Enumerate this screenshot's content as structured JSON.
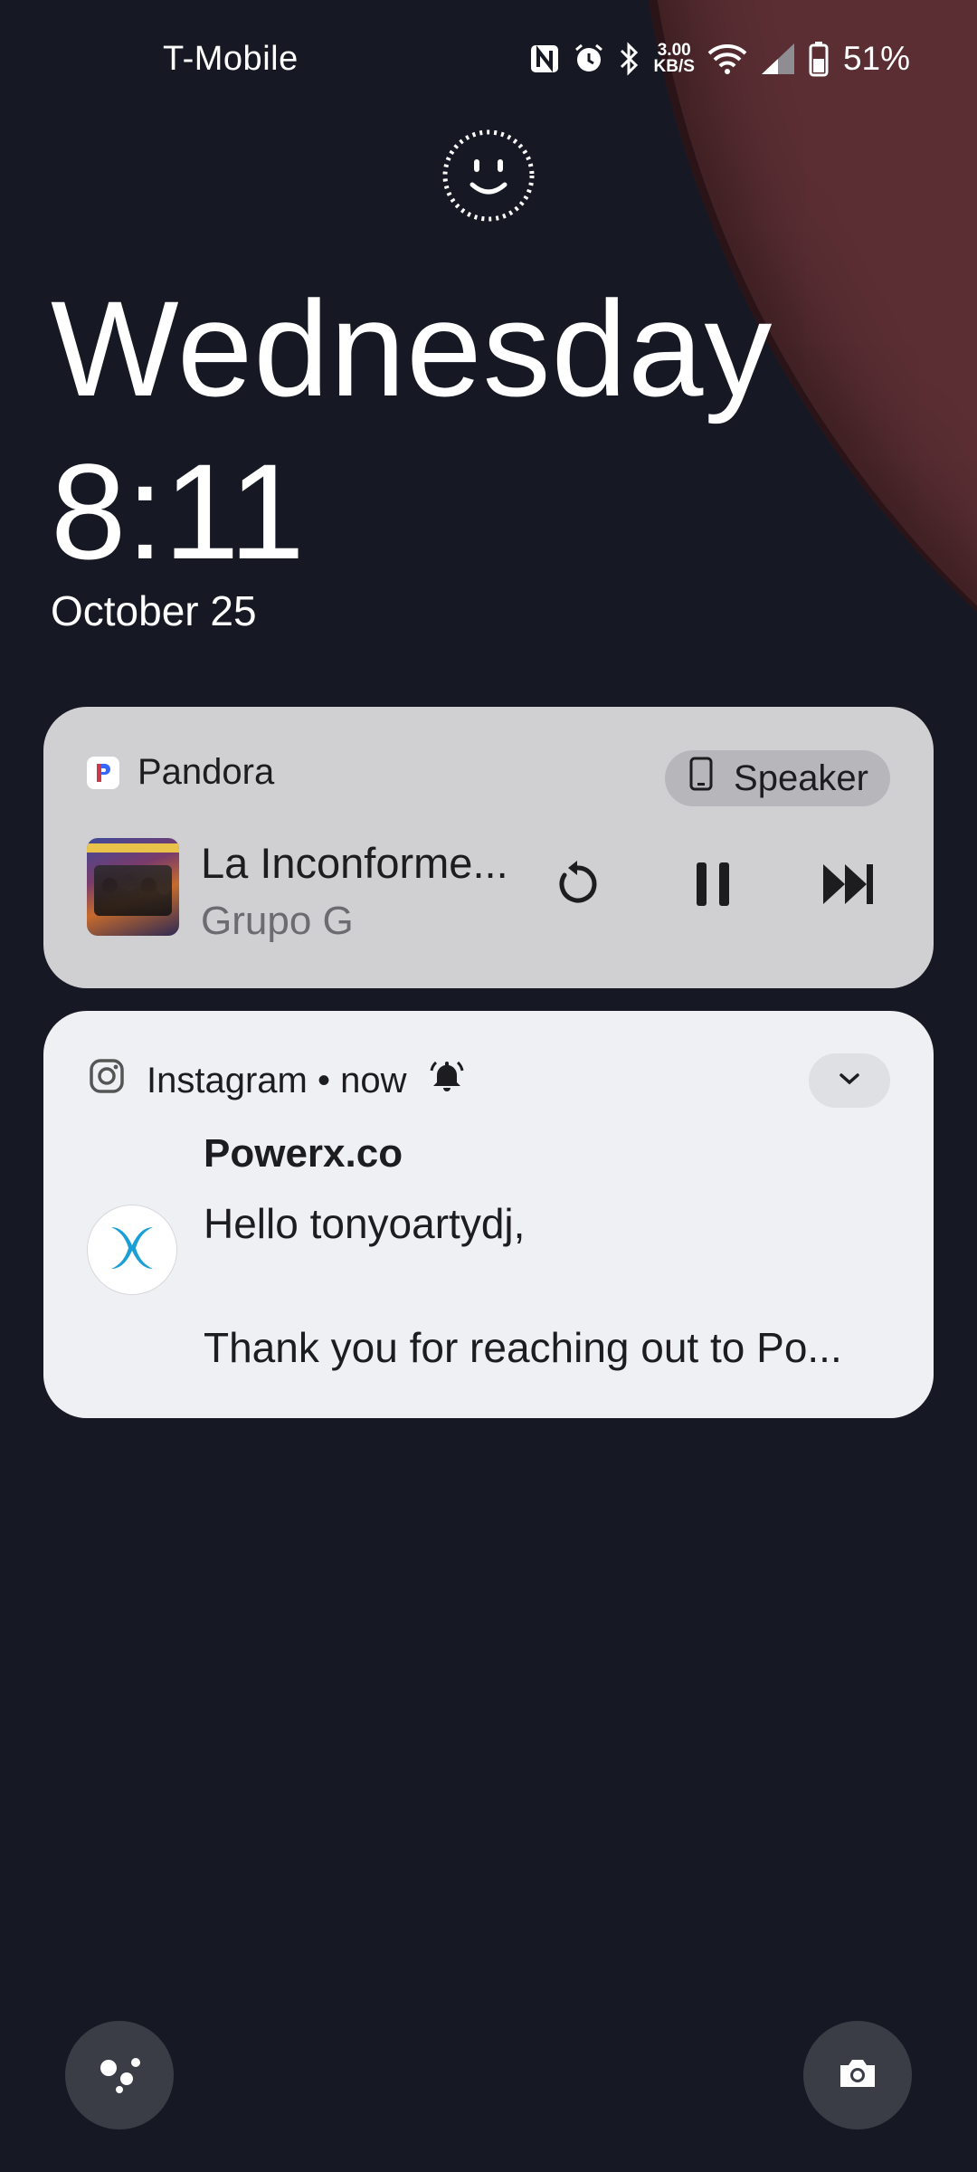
{
  "status_bar": {
    "carrier": "T-Mobile",
    "net_speed_value": "3.00",
    "net_speed_unit": "KB/S",
    "battery_percent": "51%",
    "icons": [
      "nfc-icon",
      "alarm-icon",
      "bluetooth-icon",
      "wifi-icon",
      "signal-icon",
      "battery-icon"
    ]
  },
  "lock": {
    "face_unlock_icon": "face-unlock-icon",
    "day": "Wednesday",
    "time": "8:11",
    "date": "October 25"
  },
  "media": {
    "app_name": "Pandora",
    "output_label": "Speaker",
    "track_title": "La Inconforme...",
    "artist": "Grupo G",
    "controls": [
      "replay-icon",
      "pause-icon",
      "skip-next-icon"
    ],
    "colors": {
      "card_bg": "#d0d0d3",
      "chip_bg": "#b7b7bb"
    }
  },
  "notification": {
    "app_name": "Instagram",
    "separator": "•",
    "time": "now",
    "sender": "Powerx.co",
    "line1": "Hello tonyoartydj,",
    "line2": "Thank you for reaching out to Po...",
    "colors": {
      "card_bg": "#eff0f4",
      "avatar_accent": "#1a9fd6"
    }
  },
  "shortcuts": {
    "left": "assistant-icon",
    "right": "camera-icon"
  }
}
